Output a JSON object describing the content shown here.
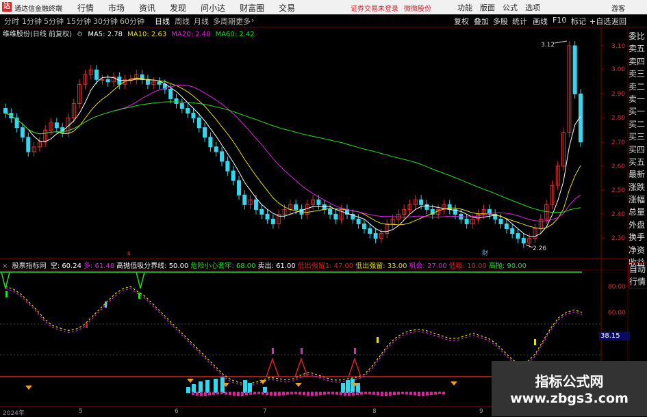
{
  "titlebar": {
    "logo": "达",
    "app_title": "通达信金融终端",
    "menu": [
      "行情",
      "市场",
      "资讯",
      "发现",
      "问小达",
      "财富圈",
      "交易"
    ],
    "warning": "证券交易未登录",
    "warning2": "微微股份",
    "right_menu": [
      "功能",
      "版面",
      "公式",
      "选项"
    ],
    "guest": "游客"
  },
  "period_tabs": [
    {
      "label": "分时",
      "selected": false
    },
    {
      "label": "1分钟",
      "selected": false
    },
    {
      "label": "5分钟",
      "selected": false
    },
    {
      "label": "15分钟",
      "selected": false
    },
    {
      "label": "30分钟",
      "selected": false
    },
    {
      "label": "60分钟",
      "selected": false
    },
    {
      "label": "日线",
      "selected": true
    },
    {
      "label": "周线",
      "selected": false
    },
    {
      "label": "月线",
      "selected": false
    },
    {
      "label": "多周期",
      "selected": false
    },
    {
      "label": "更多",
      "selected": false
    }
  ],
  "toolbar_right": [
    "复权",
    "叠加",
    "多股",
    "统计",
    "画线",
    "F10",
    "标记",
    "+自选",
    "返回"
  ],
  "chart_info": {
    "stock": "维维股份(日线 前复权)",
    "ma": [
      {
        "label": "MA5: 2.78",
        "color": "#ffffff"
      },
      {
        "label": "MA10: 2.63",
        "color": "#e8e000"
      },
      {
        "label": "MA20: 2.48",
        "color": "#e020e0"
      },
      {
        "label": "MA60: 2.42",
        "color": "#20e020"
      }
    ]
  },
  "right_panel": [
    "委比",
    "卖五",
    "卖四",
    "卖三",
    "卖二",
    "卖一",
    "买一",
    "买二",
    "买三",
    "买四",
    "买五",
    "最新",
    "涨跌",
    "涨幅",
    "总量",
    "外盘",
    "换手",
    "净资",
    "收益"
  ],
  "price_axis": [
    "3.10",
    "3.00",
    "2.90",
    "2.80",
    "2.70",
    "2.60",
    "2.50",
    "2.40",
    "2.30"
  ],
  "price_marks": {
    "high": "3.12",
    "low": "2.26"
  },
  "indicator": {
    "name": "股票指标网",
    "items": [
      {
        "label": "空: 60.24",
        "color": "#ffffff"
      },
      {
        "label": "多: 61.48",
        "color": "#e020e0"
      },
      {
        "label": "高抛低吸分界线: 50.00",
        "color": "#ffffff"
      },
      {
        "label": "危险小心套牢: 68.00",
        "color": "#20e020"
      },
      {
        "label": "卖出: 61.00",
        "color": "#ffffff"
      },
      {
        "label": "低出强留1: 47.00",
        "color": "#e02020"
      },
      {
        "label": "低出强留: 33.00",
        "color": "#e8e000"
      },
      {
        "label": "机会: 27.00",
        "color": "#e020e0"
      },
      {
        "label": "低吸: 10.00",
        "color": "#e02020"
      },
      {
        "label": "高抛: 90.00",
        "color": "#20e020"
      }
    ],
    "axis": [
      "80.00",
      "60.00"
    ],
    "current": "38.15"
  },
  "auto_trade": [
    "自动",
    "行情"
  ],
  "dates": [
    "2024年",
    "5",
    "6",
    "7",
    "8",
    "9"
  ],
  "markers": {
    "red_s": "s",
    "finance": "财"
  },
  "watermark": {
    "line1": "指标公式网",
    "line2": "www.zbgs3.com"
  }
}
